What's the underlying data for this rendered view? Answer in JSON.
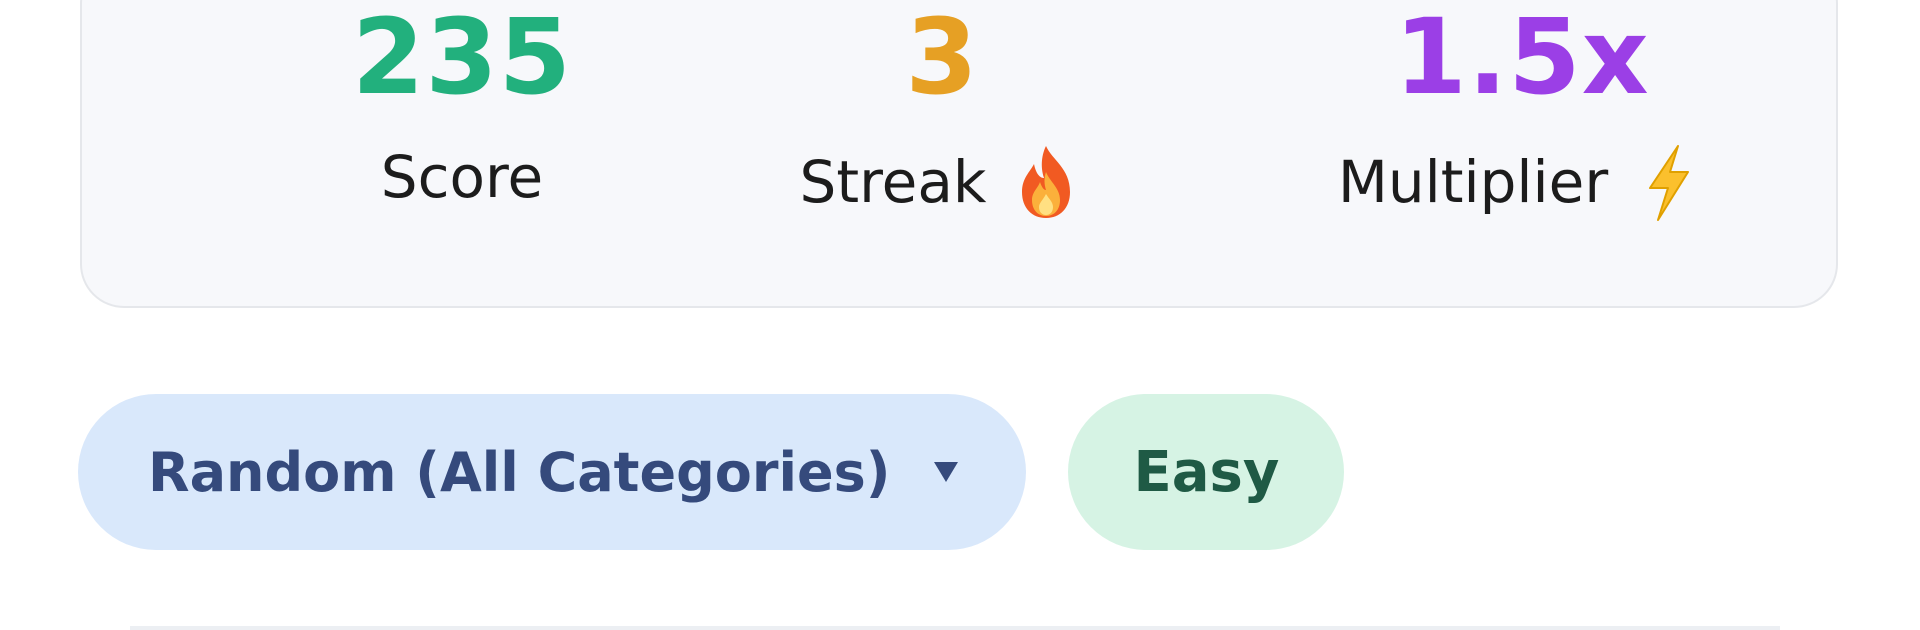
{
  "stats": {
    "score": {
      "value": "235",
      "label": "Score",
      "color": "#22b07d"
    },
    "streak": {
      "value": "3",
      "label": "Streak",
      "icon": "fire-icon",
      "color": "#e6a024"
    },
    "multiplier": {
      "value": "1.5x",
      "label": "Multiplier",
      "icon": "lightning-icon",
      "color": "#9b3fe6"
    }
  },
  "controls": {
    "category": {
      "selected": "Random (All Categories)",
      "icon": "chevron-down-icon"
    },
    "difficulty": {
      "label": "Easy"
    }
  },
  "colors": {
    "card_bg": "#f7f8fb",
    "category_bg": "#d9e8fb",
    "difficulty_bg": "#d6f3e4"
  }
}
